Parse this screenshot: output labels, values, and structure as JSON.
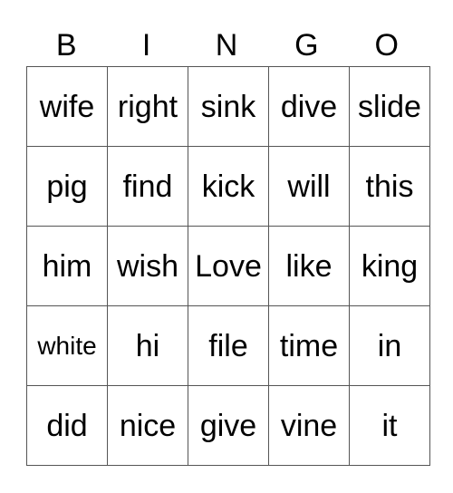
{
  "header": {
    "letters": [
      "B",
      "I",
      "N",
      "G",
      "O"
    ]
  },
  "board": {
    "rows": [
      [
        "wife",
        "right",
        "sink",
        "dive",
        "slide"
      ],
      [
        "pig",
        "find",
        "kick",
        "will",
        "this"
      ],
      [
        "him",
        "wish",
        "Love",
        "like",
        "king"
      ],
      [
        "white",
        "hi",
        "file",
        "time",
        "in"
      ],
      [
        "did",
        "nice",
        "give",
        "vine",
        "it"
      ]
    ]
  },
  "colors": {
    "grid_line": "#555555",
    "text": "#000000",
    "background": "#ffffff"
  }
}
